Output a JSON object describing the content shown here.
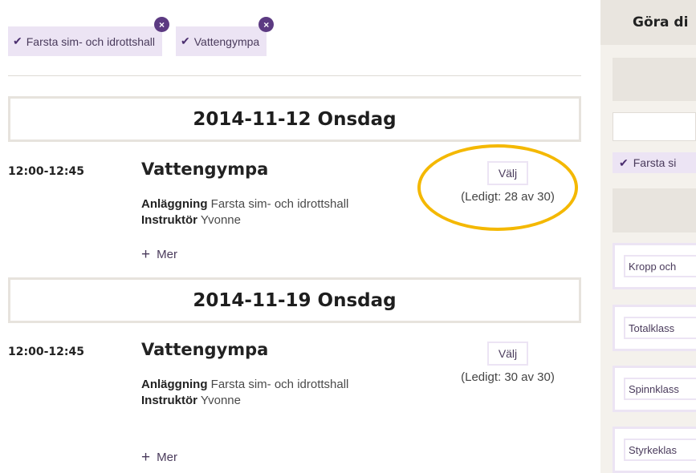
{
  "filters": [
    {
      "label": "Farsta sim- och idrottshall",
      "remove_icon": "×"
    },
    {
      "label": "Vattengympa",
      "remove_icon": "×"
    }
  ],
  "check_icon": "✔",
  "sessions": [
    {
      "date": "2014-11-12 Onsdag",
      "time": "12:00-12:45",
      "name": "Vattengympa",
      "facility_label": "Anläggning",
      "facility": "Farsta sim- och idrottshall",
      "instructor_label": "Instruktör",
      "instructor": "Yvonne",
      "more_label": "Mer",
      "select_label": "Välj",
      "availability": "(Ledigt: 28 av 30)"
    },
    {
      "date": "2014-11-19 Onsdag",
      "time": "12:00-12:45",
      "name": "Vattengympa",
      "facility_label": "Anläggning",
      "facility": "Farsta sim- och idrottshall",
      "instructor_label": "Instruktör",
      "instructor": "Yvonne",
      "more_label": "Mer",
      "select_label": "Välj",
      "availability": "(Ledigt: 30 av 30)"
    }
  ],
  "sidebar": {
    "title": "Göra di",
    "selected_filter": "Farsta si",
    "categories": [
      "Kropp och",
      "Totalklass",
      "Spinnklass",
      "Styrkeklas"
    ]
  },
  "colors": {
    "accent": "#5c3a82",
    "chip_bg": "#ece4f4",
    "highlight": "#f4b800",
    "panel_bg": "#f4f1ec"
  }
}
